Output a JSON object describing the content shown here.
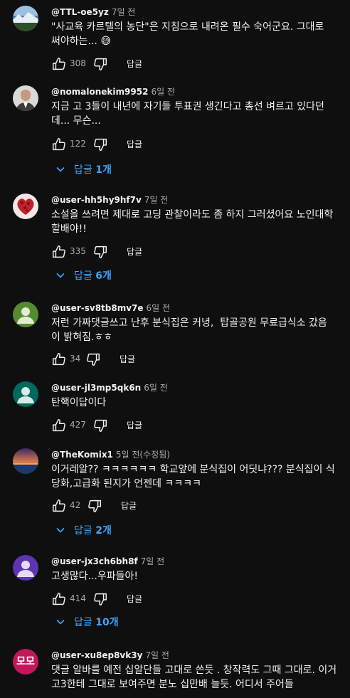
{
  "ui": {
    "reply_label": "답글",
    "replies_prefix": "답글"
  },
  "comments": [
    {
      "author": "@TTL-oe5yz",
      "time": "7일 전",
      "text": "\"사교육 카르텔의 농단\"은 지침으로 내려온 필수 숙어군요. 그대로 써야하는... 😅",
      "likes": "308",
      "replies": "",
      "avatar": {
        "type": "image",
        "colors": [
          "#4a7fb8",
          "#9cc1e0",
          "#2e4f2a"
        ]
      }
    },
    {
      "author": "@nomalonekim9952",
      "time": "6일 전",
      "text": "지금 고 3들이 내년에 자기들 투표권 생긴다고 총선 벼르고 있다던데... 무슨...",
      "likes": "122",
      "replies": "1개",
      "avatar": {
        "type": "image",
        "colors": [
          "#d9d9d9",
          "#5a4030",
          "#ffffff"
        ]
      }
    },
    {
      "author": "@user-hh5hy9hf7v",
      "time": "7일 전",
      "text": "소설을 쓰려면 제대로 고딩 관찰이라도 좀 하지 그러셨어요 노인대학할배야!!",
      "likes": "335",
      "replies": "6개",
      "avatar": {
        "type": "image",
        "colors": [
          "#f2e6e6",
          "#c0202a",
          "#7a1015"
        ]
      }
    },
    {
      "author": "@user-sv8tb8mv7e",
      "time": "6일 전",
      "text": "저런 가짜댓글쓰고 난후 분식집은 커녕,  탑골공원 무료급식소 갔음이 밝혀짐.ㅎㅎ",
      "likes": "34",
      "replies": "",
      "avatar": {
        "type": "default",
        "colors": [
          "#558b2f",
          "#e3ecd8"
        ]
      }
    },
    {
      "author": "@user-jl3mp5qk6n",
      "time": "6일 전",
      "text": "탄핵이답이다",
      "likes": "427",
      "replies": "",
      "avatar": {
        "type": "default",
        "colors": [
          "#00695c",
          "#d8ebe8"
        ]
      }
    },
    {
      "author": "@TheKomix1",
      "time": "5일 전(수정됨)",
      "text": "이거레알?? ㅋㅋㅋㅋㅋㅋ 학교앞에 분식집이 어딧냐??? 분식집이 식당화,고급화 된지가 언젠데 ㅋㅋㅋㅋ",
      "likes": "42",
      "replies": "2개",
      "avatar": {
        "type": "image",
        "colors": [
          "#3a2a6a",
          "#e07a4a",
          "#1a3a6a"
        ]
      }
    },
    {
      "author": "@user-jx3ch6bh8f",
      "time": "7일 전",
      "text": "고생많다...우파들아!",
      "likes": "414",
      "replies": "10개",
      "avatar": {
        "type": "default",
        "colors": [
          "#5e35b1",
          "#e3dcf2"
        ]
      }
    },
    {
      "author": "@user-xu8ep8vk3y",
      "time": "7일 전",
      "text": "댓글 알바를 예전 십알단들 고대로 쓴듯 . 창작력도 그때 그대로. 이거 고3한테 그대로 보여주면 분노 십만배 늘듯. 어디서 주어들",
      "likes": "",
      "replies": "",
      "avatar": {
        "type": "initials",
        "initials": "모모",
        "colors": [
          "#c2185b",
          "#ffffff"
        ]
      }
    }
  ]
}
